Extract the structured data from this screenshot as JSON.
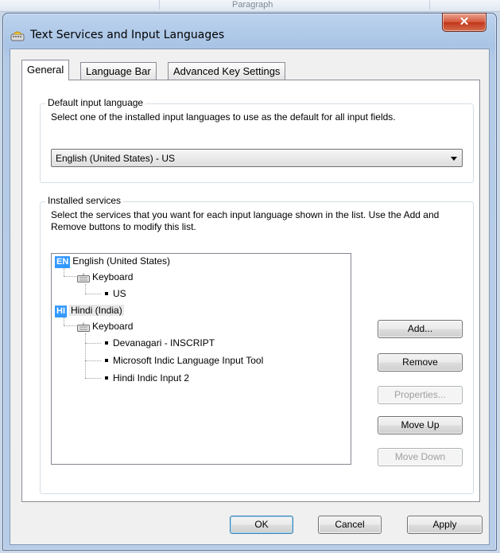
{
  "background_app": {
    "ribbon_group": "Paragraph"
  },
  "window": {
    "title": "Text Services and Input Languages",
    "close_glyph": "✕",
    "tabs": [
      {
        "label": "General",
        "active": true
      },
      {
        "label": "Language Bar",
        "active": false
      },
      {
        "label": "Advanced Key Settings",
        "active": false
      }
    ],
    "default_language": {
      "legend": "Default input language",
      "description": "Select one of the installed input languages to use as the default for all input fields.",
      "selected": "English (United States) - US"
    },
    "installed_services": {
      "legend": "Installed services",
      "description": "Select the services that you want for each input language shown in the list. Use the Add and Remove buttons to modify this list.",
      "languages": [
        {
          "badge": "EN",
          "name": "English (United States)",
          "category": "Keyboard",
          "services": [
            "US"
          ]
        },
        {
          "badge": "HI",
          "name": "Hindi (India)",
          "category": "Keyboard",
          "services": [
            "Devanagari - INSCRIPT",
            "Microsoft Indic Language Input Tool",
            "Hindi Indic Input 2"
          ]
        }
      ],
      "buttons": {
        "add": "Add...",
        "remove": "Remove",
        "properties": "Properties...",
        "move_up": "Move Up",
        "move_down": "Move Down"
      }
    },
    "footer": {
      "ok": "OK",
      "cancel": "Cancel",
      "apply": "Apply"
    }
  },
  "colors": {
    "selection": "#3399ff",
    "close_button": "#c7432a"
  }
}
